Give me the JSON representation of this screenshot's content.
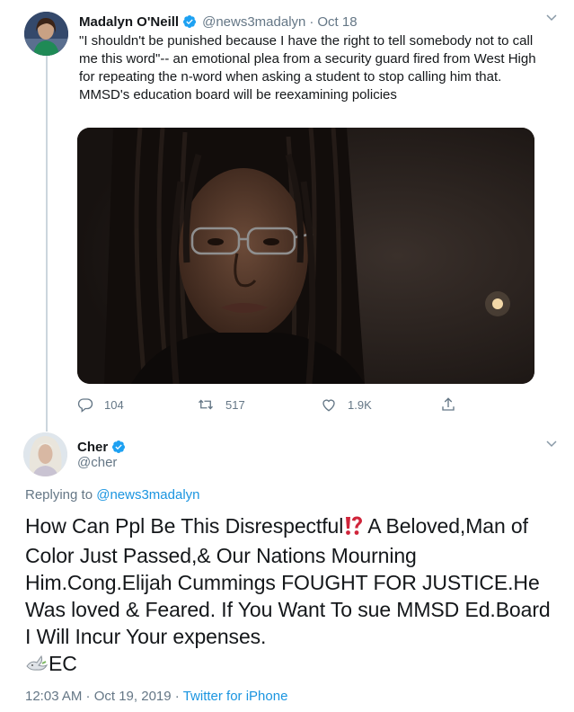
{
  "tweet1": {
    "author_name": "Madalyn O'Neill",
    "handle": "@news3madalyn",
    "separator": "·",
    "date": "Oct 18",
    "text": "\"I shouldn't be punished because I have the right to tell somebody not to call me this word\"-- an emotional plea from a security guard fired from West High for repeating the n-word when asking a student to stop calling him that. MMSD's education board will be reexamining policies",
    "actions": {
      "replies": "104",
      "retweets": "517",
      "likes": "1.9K"
    }
  },
  "tweet2": {
    "author_name": "Cher",
    "handle": "@cher",
    "replying_prefix": "Replying to",
    "replying_to": "@news3madalyn",
    "text_part1": "How Can Ppl  Be This Disrespectful",
    "text_part2": "A Beloved,Man of Color Just Passed,& Our Nations Mourning Him.Cong.Elijah Cummings FOUGHT FOR JUSTICE.He Was loved & Feared. If You Want To sue MMSD Ed.Board I Will Incur Your expenses.",
    "text_part3": "EC",
    "timestamp": "12:03 AM · Oct 19, 2019",
    "meta_separator": "·",
    "source": "Twitter for iPhone"
  },
  "colors": {
    "text": "#14171a",
    "secondary": "#657786",
    "link": "#1b95e0",
    "verified": "#1da1f2",
    "thread_line": "#ccd6dd"
  },
  "icons": [
    "verified-badge-icon",
    "chevron-down-icon",
    "reply-icon",
    "retweet-icon",
    "like-icon",
    "share-icon",
    "interrobang-emoji-icon",
    "dove-emoji-icon"
  ]
}
